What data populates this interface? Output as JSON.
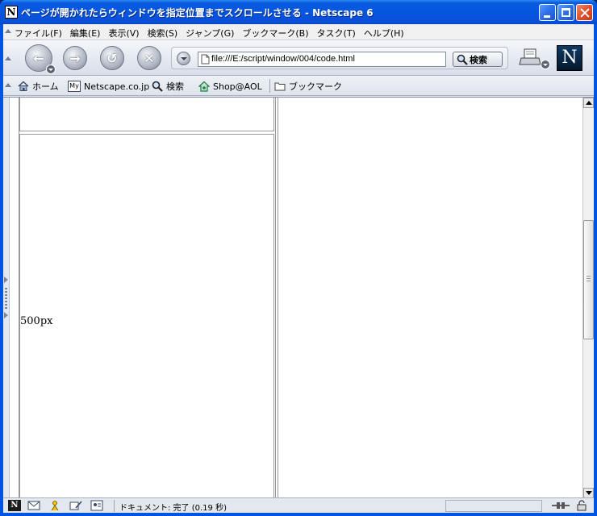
{
  "window": {
    "title": "ページが開かれたらウィンドウを指定位置までスクロールさせる - Netscape 6",
    "app_icon_letter": "N"
  },
  "menu": {
    "items": [
      {
        "label": "ファイル(F)"
      },
      {
        "label": "編集(E)"
      },
      {
        "label": "表示(V)"
      },
      {
        "label": "検索(S)"
      },
      {
        "label": "ジャンプ(G)"
      },
      {
        "label": "ブックマーク(B)"
      },
      {
        "label": "タスク(T)"
      },
      {
        "label": "ヘルプ(H)"
      }
    ]
  },
  "navbar": {
    "url": "file:///E:/script/window/004/code.html",
    "search_label": "検索",
    "logo_letter": "N"
  },
  "personal_toolbar": {
    "home": "ホーム",
    "netscape": "Netscape.co.jp",
    "netscape_prefix": "My",
    "search": "検索",
    "shop": "Shop@AOL",
    "bookmarks": "ブックマーク"
  },
  "page": {
    "cell_text": "500px"
  },
  "statusbar": {
    "text": "ドキュメント: 完了 (0.19 秒)",
    "netscape_letter": "N"
  },
  "colors": {
    "titlebar": "#0556e0",
    "close_button": "#e0502a",
    "frame_border": "#9a9a9a"
  }
}
